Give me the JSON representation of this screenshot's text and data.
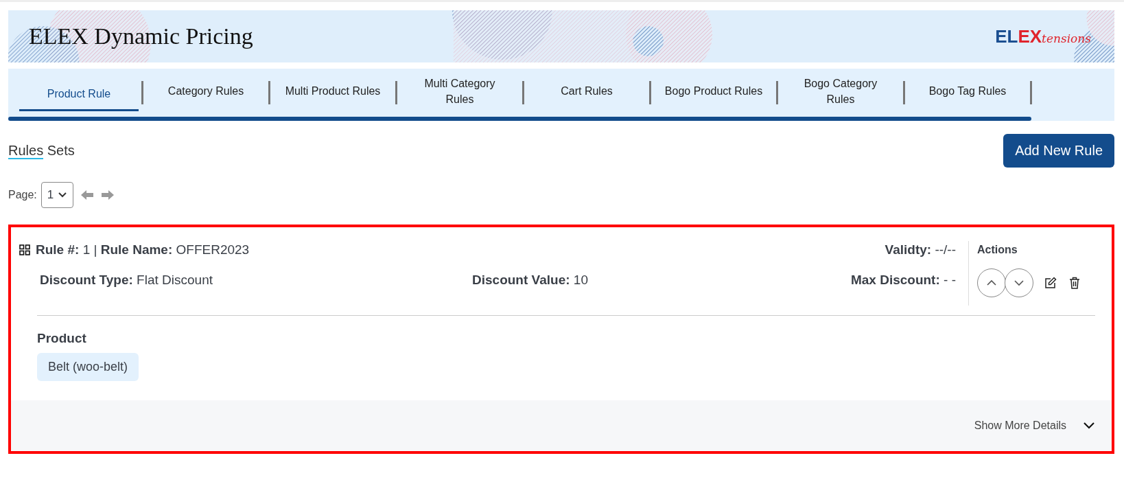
{
  "header": {
    "title": "ELEX Dynamic Pricing",
    "logo": {
      "strong_blue": "EL",
      "strong_red": "EX",
      "script": "tensions"
    }
  },
  "tabs": [
    {
      "label": "Product Rule",
      "selected": true
    },
    {
      "label": "Category Rules",
      "selected": false
    },
    {
      "label": "Multi Product Rules",
      "selected": false
    },
    {
      "label": "Multi Category Rules",
      "selected": false
    },
    {
      "label": "Cart Rules",
      "selected": false
    },
    {
      "label": "Bogo Product Rules",
      "selected": false
    },
    {
      "label": "Bogo Category Rules",
      "selected": false
    },
    {
      "label": "Bogo Tag Rules",
      "selected": false
    }
  ],
  "section": {
    "title_underlined": "Rules",
    "title_rest": "Sets",
    "add_button": "Add New Rule"
  },
  "pagination": {
    "label": "Page:",
    "value": "1"
  },
  "rules": [
    {
      "line1": "**Rule #:** 1 | **Rule Name:** OFFER2023",
      "validity": "**Validty:** --/--",
      "discount_type": "**Discount Type:** Flat Discount",
      "discount_value": "**Discount Value:** 10",
      "max_discount": "**Max Discount:** - -",
      "actions_title": "Actions",
      "product_heading": "Product",
      "products": [
        "Belt (woo-belt)"
      ],
      "show_more": "Show More Details"
    }
  ]
}
